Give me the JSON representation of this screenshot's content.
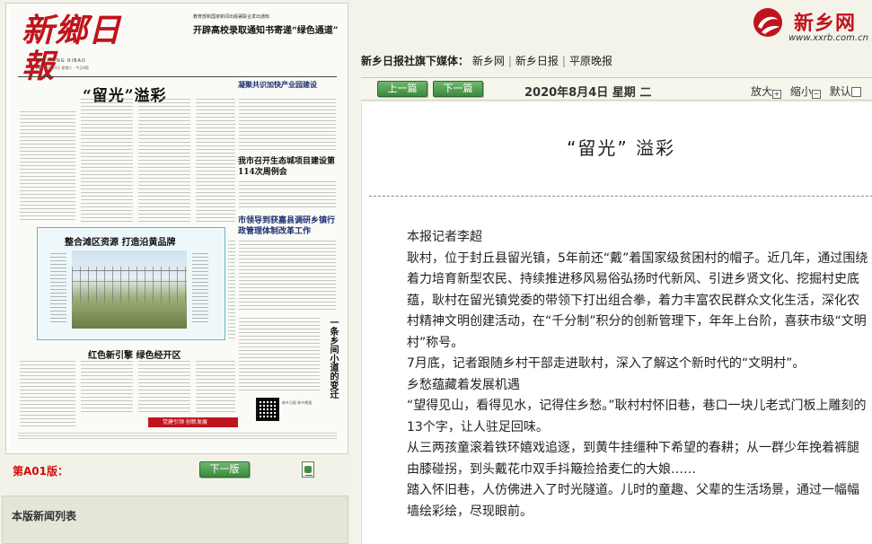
{
  "newspaper": {
    "masthead": "新鄉日報",
    "masthead_pinyin": "XINXIANG RIBAO",
    "masthead_info": "2020年8月4日 星期二 · 今日8版",
    "top_notice": "教育部和国家新闻出版署联合发出通知",
    "top_headline": "开辟高校录取通知书寄递“绿色通道”",
    "lead_headline": "“留光”溢彩",
    "side_headline_1": "凝聚共识加快产业园建设",
    "side_headline_2": "我市召开生态城项目建设第114次周例会",
    "side_headline_3": "市领导到获嘉县调研乡镇行政管理体制改革工作",
    "photo_headline": "整合滩区资源 打造沿黄品牌",
    "bottom_headline": "红色新引擎 绿色经开区",
    "vertical_headline": "一条乡间小道的变迁",
    "qr_caption": "新乡日报 新乡晚报",
    "red_banner": "党建引领 创新发展"
  },
  "left_nav": {
    "page_label": "第A01版：",
    "next_page_button": "下一版",
    "pdf_icon": "pdf-icon"
  },
  "news_list": {
    "title": "本版新闻列表"
  },
  "brand": {
    "name": "新乡网",
    "url": "www.xxrb.com.cn",
    "accent": "#c0141c"
  },
  "media_row": {
    "label": "新乡日报社旗下媒体：",
    "links": [
      "新乡网",
      "新乡日报",
      "平原晚报"
    ]
  },
  "toolbar": {
    "prev_button": "上一篇",
    "next_button": "下一篇",
    "date": "2020年8月4日 星期 二",
    "zoom_in_label": "放大",
    "zoom_out_label": "缩小",
    "default_label": "默认"
  },
  "article": {
    "title": "“留光” 溢彩",
    "paragraphs": [
      "本报记者李超",
      "耿村，位于封丘县留光镇，5年前还“戴”着国家级贫困村的帽子。近几年，通过围绕着力培育新型农民、持续推进移风易俗弘扬时代新风、引进乡贤文化、挖掘村史底蕴，耿村在留光镇党委的带领下打出组合拳，着力丰富农民群众文化生活，深化农村精神文明创建活动，在“千分制”积分的创新管理下，年年上台阶，喜获市级“文明村”称号。",
      "7月底，记者跟随乡村干部走进耿村，深入了解这个新时代的“文明村”。",
      "乡愁蕴藏着发展机遇",
      "“望得见山，看得见水，记得住乡愁。”耿村村怀旧巷，巷口一块儿老式门板上雕刻的13个字，让人驻足回味。",
      "从三两孩童滚着铁环嬉戏追逐，到黄牛挂缰种下希望的春耕；从一群少年挽着裤腿由膝碰拐，到头戴花巾双手抖簸捡拾麦仁的大娘……",
      "踏入怀旧巷，人仿佛进入了时光隧道。儿时的童趣、父辈的生活场景，通过一幅幅墙绘彩绘，尽现眼前。"
    ]
  }
}
